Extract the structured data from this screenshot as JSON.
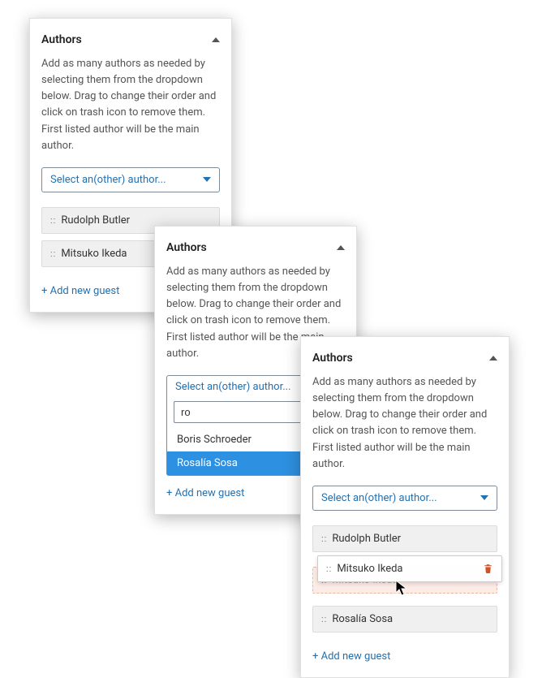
{
  "shared": {
    "title": "Authors",
    "description": "Add as many authors as needed by selecting them from the dropdown below. Drag to change their order and click on trash icon to remove them. First listed author will be the main author.",
    "placeholder": "Select an(other) author...",
    "add_link": "+ Add new guest"
  },
  "panel1": {
    "authors": [
      {
        "name": "Rudolph Butler"
      },
      {
        "name": "Mitsuko Ikeda"
      }
    ]
  },
  "panel2": {
    "search_value": "ro",
    "options": [
      {
        "label": "Boris Schroeder",
        "highlight": false
      },
      {
        "label": "Rosalía Sosa",
        "highlight": true
      }
    ]
  },
  "panel3": {
    "authors": [
      {
        "name": "Rudolph Butler"
      },
      {
        "name": "Mitsuko Ikeda"
      },
      {
        "name": "Rosalía Sosa"
      }
    ],
    "ghost_name": "Mitsuko Ikeda"
  }
}
